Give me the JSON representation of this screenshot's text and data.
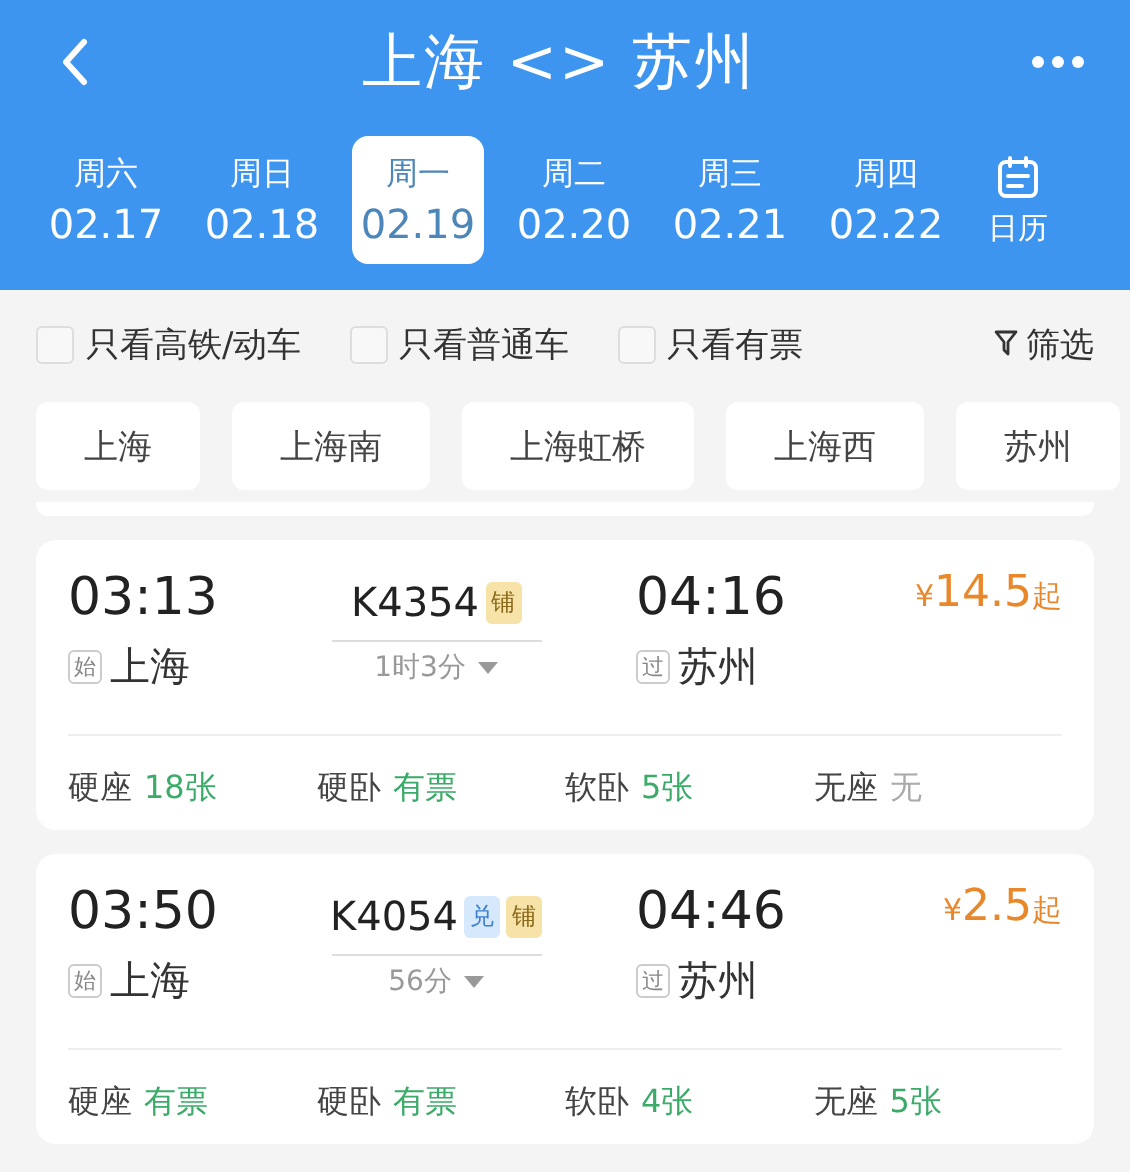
{
  "header": {
    "title": "上海 <> 苏州"
  },
  "dates": [
    {
      "weekday": "周六",
      "date": "02.17",
      "selected": false
    },
    {
      "weekday": "周日",
      "date": "02.18",
      "selected": false
    },
    {
      "weekday": "周一",
      "date": "02.19",
      "selected": true
    },
    {
      "weekday": "周二",
      "date": "02.20",
      "selected": false
    },
    {
      "weekday": "周三",
      "date": "02.21",
      "selected": false
    },
    {
      "weekday": "周四",
      "date": "02.22",
      "selected": false
    }
  ],
  "calendar_label": "日历",
  "filters": [
    {
      "label": "只看高铁/动车",
      "checked": false
    },
    {
      "label": "只看普通车",
      "checked": false
    },
    {
      "label": "只看有票",
      "checked": false
    }
  ],
  "filter_button": "筛选",
  "stations": [
    "上海",
    "上海南",
    "上海虹桥",
    "上海西",
    "苏州"
  ],
  "trains": [
    {
      "depart_time": "03:13",
      "depart_tag": "始",
      "depart_station": "上海",
      "number": "K4354",
      "badges": [
        {
          "kind": "sleeper",
          "text": "铺"
        }
      ],
      "duration": "1时3分",
      "arrive_time": "04:16",
      "arrive_tag": "过",
      "arrive_station": "苏州",
      "currency": "¥",
      "price": "14.5",
      "price_suffix": "起",
      "seats": [
        {
          "type": "硬座",
          "count": "18张",
          "available": true
        },
        {
          "type": "硬卧",
          "count": "有票",
          "available": true
        },
        {
          "type": "软卧",
          "count": "5张",
          "available": true
        },
        {
          "type": "无座",
          "count": "无",
          "available": false
        }
      ]
    },
    {
      "depart_time": "03:50",
      "depart_tag": "始",
      "depart_station": "上海",
      "number": "K4054",
      "badges": [
        {
          "kind": "exchange",
          "text": "兑"
        },
        {
          "kind": "sleeper",
          "text": "铺"
        }
      ],
      "duration": "56分",
      "arrive_time": "04:46",
      "arrive_tag": "过",
      "arrive_station": "苏州",
      "currency": "¥",
      "price": "2.5",
      "price_suffix": "起",
      "seats": [
        {
          "type": "硬座",
          "count": "有票",
          "available": true
        },
        {
          "type": "硬卧",
          "count": "有票",
          "available": true
        },
        {
          "type": "软卧",
          "count": "4张",
          "available": true
        },
        {
          "type": "无座",
          "count": "5张",
          "available": true
        }
      ]
    }
  ]
}
